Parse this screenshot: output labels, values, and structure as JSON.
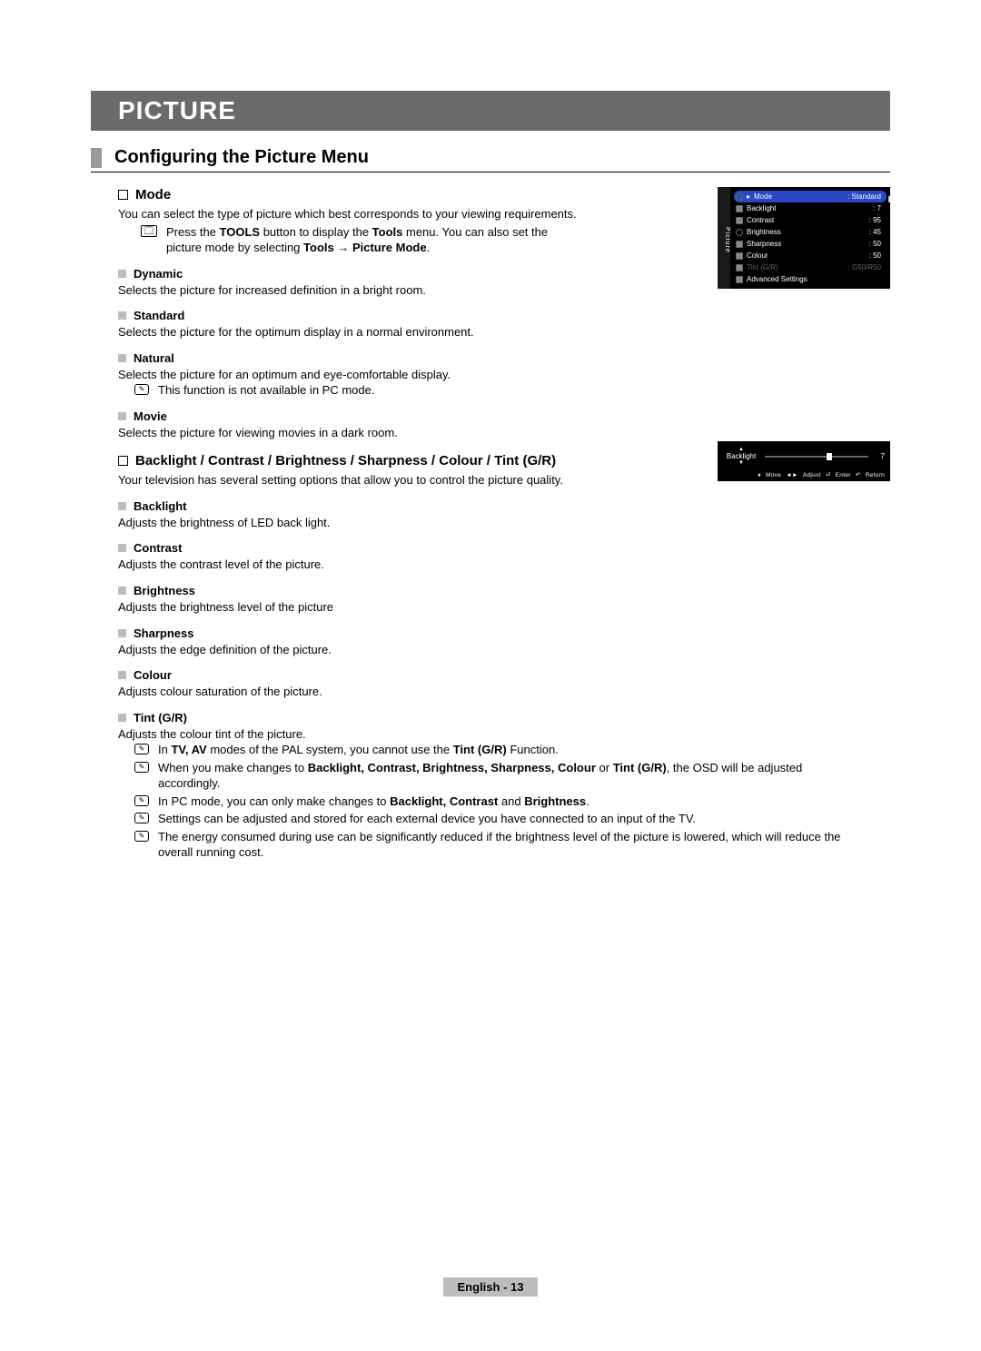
{
  "titleBar": "PICTURE",
  "subheading": "Configuring the Picture Menu",
  "sec1": {
    "title": "Mode",
    "intro": "You can select the type of picture which best corresponds to your viewing requirements.",
    "toolsNote_a": "Press the ",
    "toolsNote_b": "TOOLS",
    "toolsNote_c": " button to display the ",
    "toolsNote_d": "Tools",
    "toolsNote_e": " menu. You can also set the picture mode by selecting ",
    "toolsNote_f": "Tools → Picture Mode",
    "toolsNote_g": ".",
    "items": [
      {
        "name": "Dynamic",
        "desc": "Selects the picture for increased definition in a bright room."
      },
      {
        "name": "Standard",
        "desc": "Selects the picture for the optimum display in a normal environment."
      },
      {
        "name": "Natural",
        "desc": "Selects the picture for an optimum and eye-comfortable display.",
        "note": "This function is not available in PC mode."
      },
      {
        "name": "Movie",
        "desc": "Selects the picture for viewing movies in a dark room."
      }
    ]
  },
  "sec2": {
    "title": "Backlight / Contrast / Brightness / Sharpness / Colour / Tint (G/R)",
    "intro": "Your television has several setting options that allow you to control the picture quality.",
    "items": [
      {
        "name": "Backlight",
        "desc": "Adjusts the brightness of LED back light."
      },
      {
        "name": "Contrast",
        "desc": "Adjusts the contrast level of the picture."
      },
      {
        "name": "Brightness",
        "desc": "Adjusts the brightness level of the picture"
      },
      {
        "name": "Sharpness",
        "desc": "Adjusts the edge definition of the picture."
      },
      {
        "name": "Colour",
        "desc": "Adjusts colour saturation of the picture."
      },
      {
        "name": "Tint (G/R)",
        "desc": "Adjusts the colour tint of the picture."
      }
    ],
    "notes": {
      "n1_a": "In ",
      "n1_b": "TV, AV",
      "n1_c": " modes of the PAL system, you cannot use the ",
      "n1_d": "Tint (G/R)",
      "n1_e": " Function.",
      "n2_a": "When you make changes to ",
      "n2_b": "Backlight, Contrast, Brightness, Sharpness, Colour",
      "n2_c": " or ",
      "n2_d": "Tint (G/R)",
      "n2_e": ", the OSD will be adjusted accordingly.",
      "n3_a": "In PC mode, you can only make changes to ",
      "n3_b": "Backlight, Contrast",
      "n3_c": " and ",
      "n3_d": "Brightness",
      "n3_e": ".",
      "n4": "Settings can be adjusted and stored for each external device you have connected to an input of the TV.",
      "n5": "The energy consumed during use can be significantly reduced if the brightness level of the picture is lowered, which will reduce the overall running cost."
    }
  },
  "osdMenu": {
    "sidebar": "Picture",
    "rows": [
      {
        "label": "Mode",
        "value": ": Standard",
        "sel": true
      },
      {
        "label": "Backlight",
        "value": ": 7"
      },
      {
        "label": "Contrast",
        "value": ": 95"
      },
      {
        "label": "Brightness",
        "value": ": 45"
      },
      {
        "label": "Sharpness",
        "value": ": 50"
      },
      {
        "label": "Colour",
        "value": ": 50"
      },
      {
        "label": "Tint (G/R)",
        "value": ": G50/R50",
        "dim": true
      },
      {
        "label": "Advanced Settings",
        "value": ""
      }
    ]
  },
  "osdSlider": {
    "label": "Backlight",
    "value": "7",
    "legend": {
      "move": "Move",
      "adjust": "Adjust",
      "enter": "Enter",
      "ret": "Return"
    }
  },
  "footer": "English - 13"
}
